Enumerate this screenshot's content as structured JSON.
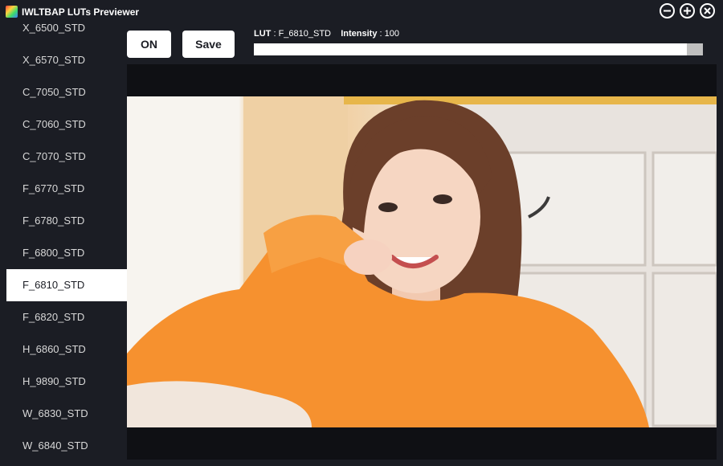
{
  "window": {
    "title": "IWLTBAP LUTs Previewer"
  },
  "sidebar": {
    "items": [
      {
        "label": "X_6500_STD"
      },
      {
        "label": "X_6570_STD"
      },
      {
        "label": "C_7050_STD"
      },
      {
        "label": "C_7060_STD"
      },
      {
        "label": "C_7070_STD"
      },
      {
        "label": "F_6770_STD"
      },
      {
        "label": "F_6780_STD"
      },
      {
        "label": "F_6800_STD"
      },
      {
        "label": "F_6810_STD",
        "selected": true
      },
      {
        "label": "F_6820_STD"
      },
      {
        "label": "H_6860_STD"
      },
      {
        "label": "H_9890_STD"
      },
      {
        "label": "W_6830_STD"
      },
      {
        "label": "W_6840_STD"
      }
    ]
  },
  "toolbar": {
    "on_label": "ON",
    "save_label": "Save",
    "lut_label": "LUT",
    "lut_value": ": F_6810_STD",
    "intensity_label": "Intensity",
    "intensity_value": ": 100",
    "intensity_fraction": 0.964
  },
  "icons": {
    "minimize": "minimize-icon",
    "maximize": "maximize-icon",
    "close": "close-icon",
    "app": "app-icon"
  },
  "colors": {
    "background": "#1b1d24",
    "viewer": "#0f1014",
    "accent": "#ffffff"
  }
}
